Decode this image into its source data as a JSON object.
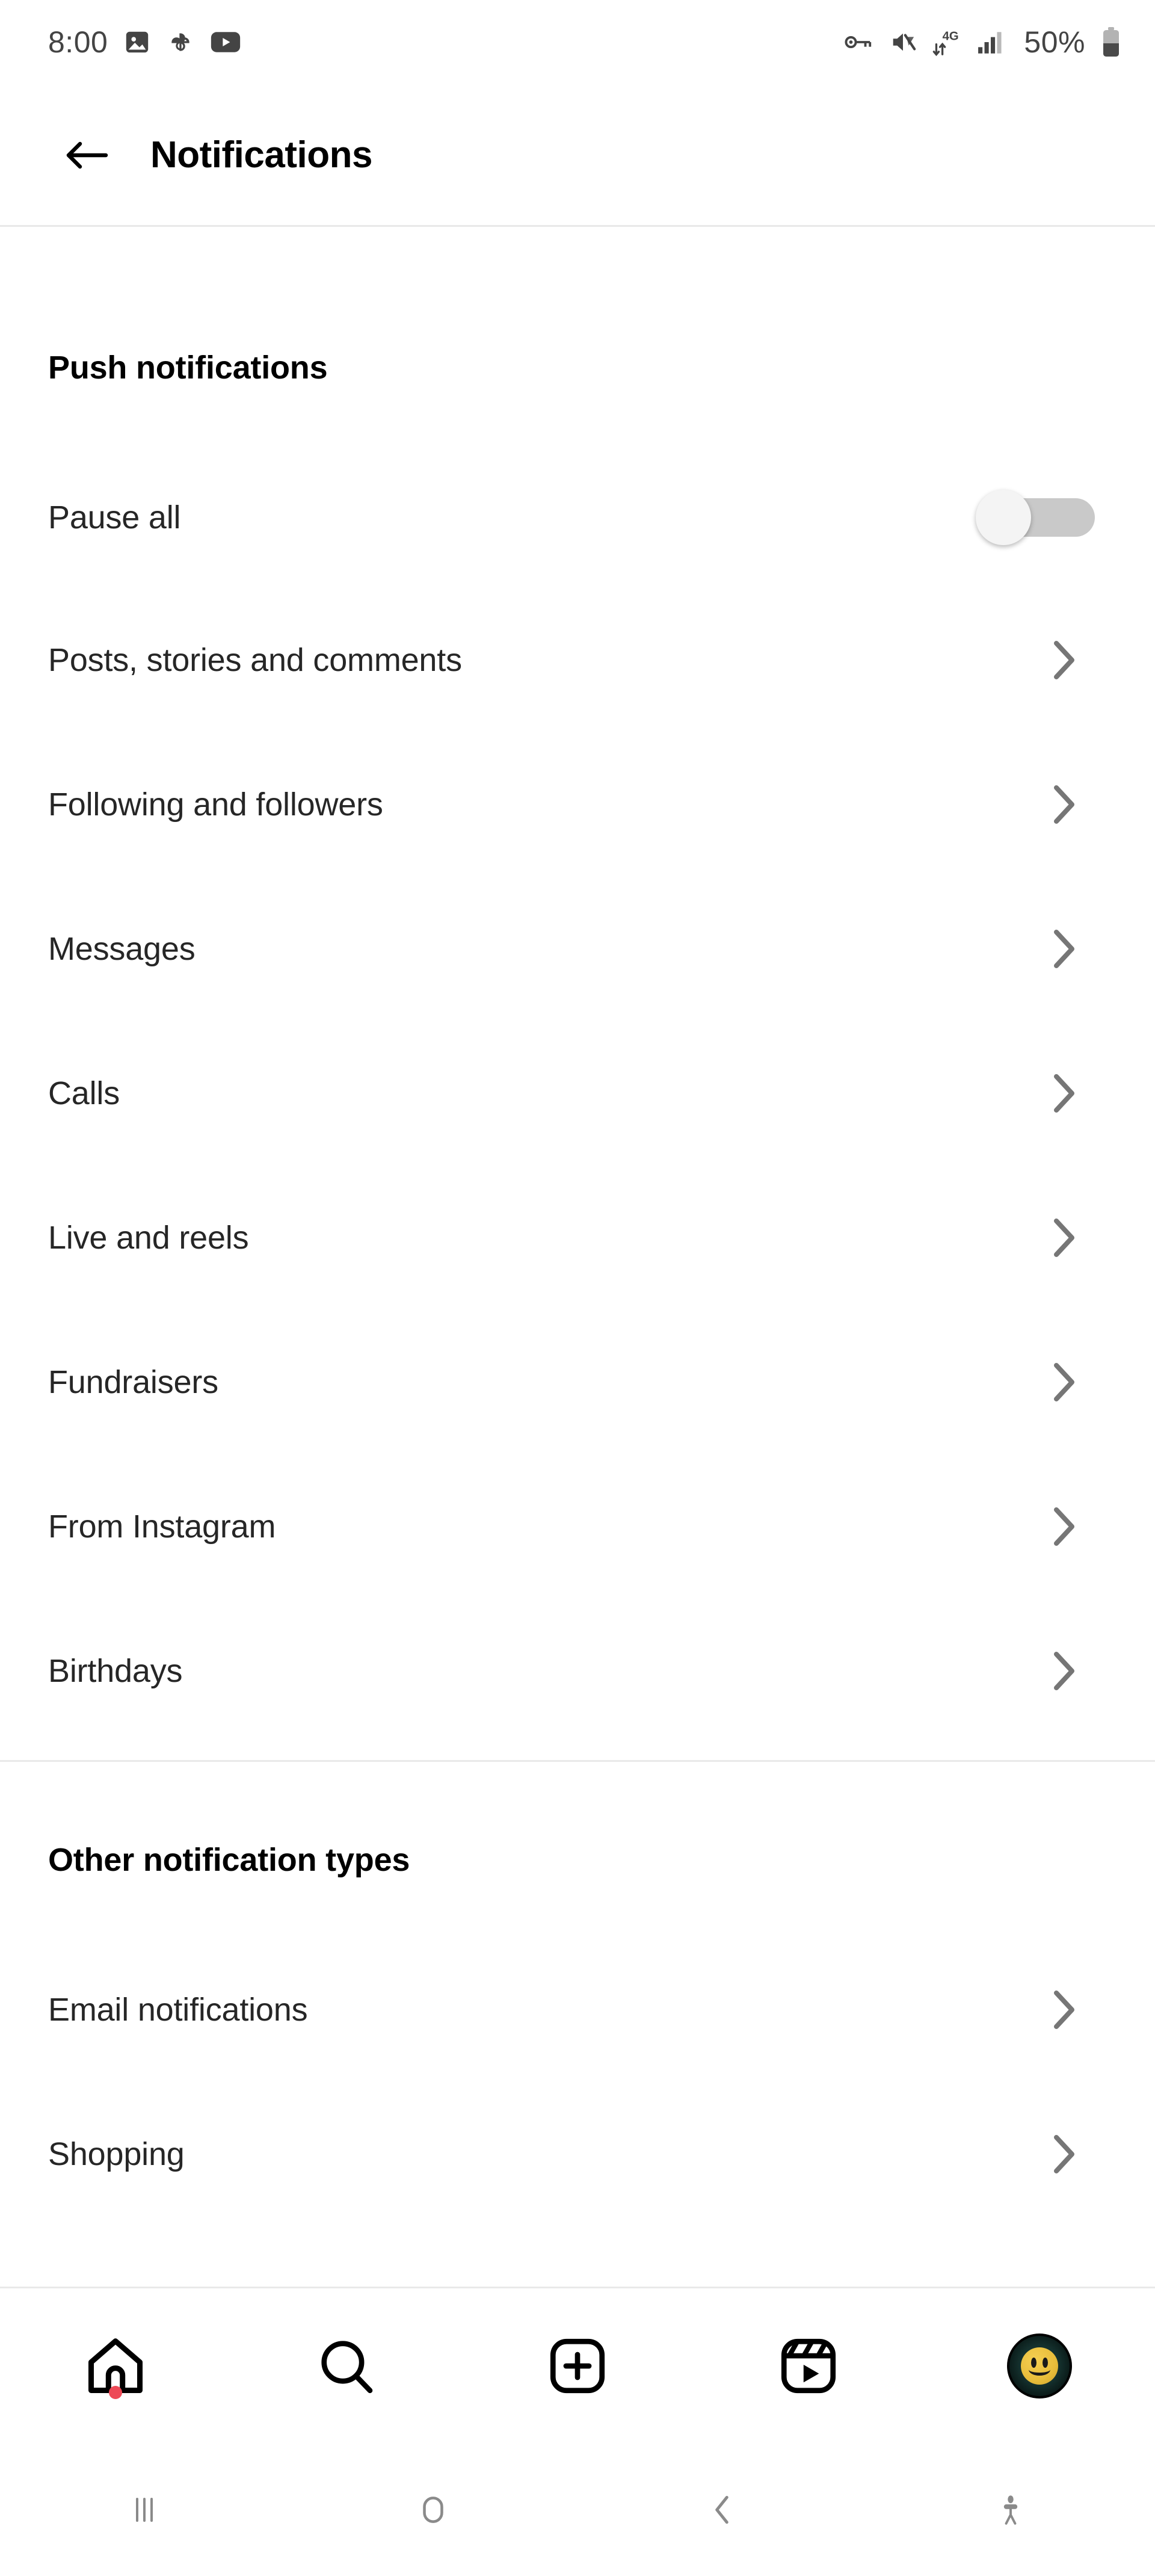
{
  "status_bar": {
    "time": "8:00",
    "battery_percent": "50%",
    "left_icons": [
      "photos-icon",
      "google-photos-pinwheel-icon",
      "youtube-icon"
    ],
    "right_icons": [
      "vpn-key-icon",
      "mute-icon",
      "4g-data-icon",
      "signal-bars-icon",
      "battery-icon"
    ],
    "network_label": "4G"
  },
  "header": {
    "back_icon": "back-arrow-icon",
    "title": "Notifications"
  },
  "sections": [
    {
      "id": "push",
      "title": "Push notifications",
      "rows": [
        {
          "label": "Pause all",
          "control": "toggle",
          "toggle_on": false
        },
        {
          "label": "Posts, stories and comments",
          "control": "chevron"
        },
        {
          "label": "Following and followers",
          "control": "chevron"
        },
        {
          "label": "Messages",
          "control": "chevron"
        },
        {
          "label": "Calls",
          "control": "chevron"
        },
        {
          "label": "Live and reels",
          "control": "chevron"
        },
        {
          "label": "Fundraisers",
          "control": "chevron"
        },
        {
          "label": "From Instagram",
          "control": "chevron"
        },
        {
          "label": "Birthdays",
          "control": "chevron"
        }
      ]
    },
    {
      "id": "other",
      "title": "Other notification types",
      "rows": [
        {
          "label": "Email notifications",
          "control": "chevron"
        },
        {
          "label": "Shopping",
          "control": "chevron"
        }
      ]
    }
  ],
  "bottom_nav": {
    "items": [
      {
        "icon": "home-icon",
        "badge": true
      },
      {
        "icon": "search-icon",
        "badge": false
      },
      {
        "icon": "create-plus-icon",
        "badge": false
      },
      {
        "icon": "reels-icon",
        "badge": false
      },
      {
        "icon": "profile-avatar",
        "badge": false
      }
    ]
  },
  "system_nav": {
    "items": [
      "recents-icon",
      "home-pill-icon",
      "back-chevron-icon",
      "accessibility-icon"
    ]
  },
  "colors": {
    "text_primary": "#262626",
    "text_title": "#000000",
    "divider": "#e9e9e9",
    "chevron": "#767676",
    "toggle_track_off": "#c9c9c9",
    "badge_red": "#ed4956",
    "background": "#ffffff",
    "status_icon": "#444444"
  }
}
